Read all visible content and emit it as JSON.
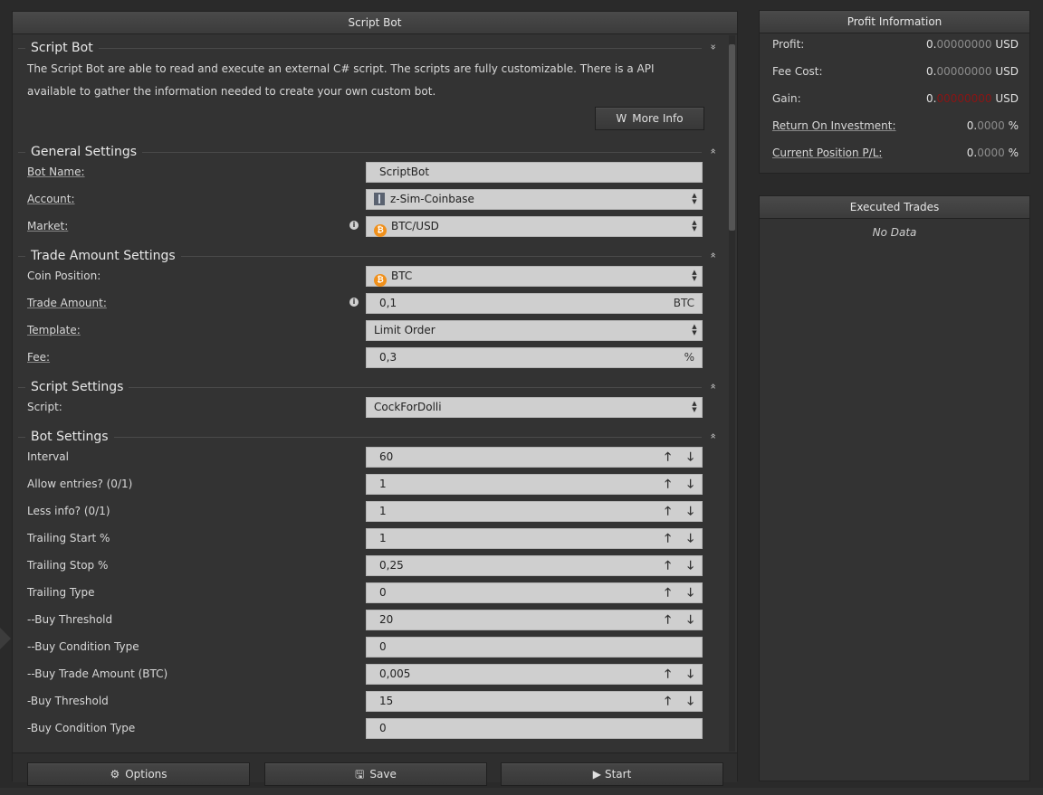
{
  "main": {
    "title": "Script Bot",
    "intro": {
      "title": "Script Bot",
      "toggle": "»",
      "description": "The Script Bot are able to read and execute an external C# script. The scripts are fully customizable. There is a API available to gather the information needed to create your own custom bot.",
      "more_info_label": "More Info",
      "more_info_icon": "W"
    },
    "general": {
      "title": "General Settings",
      "toggle": "«",
      "bot_name_label": "Bot Name:",
      "bot_name_value": "ScriptBot",
      "account_label": "Account:",
      "account_value": "z-Sim-Coinbase",
      "market_label": "Market:",
      "market_value": "BTC/USD"
    },
    "trade": {
      "title": "Trade Amount Settings",
      "toggle": "«",
      "coin_label": "Coin Position:",
      "coin_value": "BTC",
      "amount_label": "Trade Amount:",
      "amount_value": "0,1",
      "amount_suffix": "BTC",
      "template_label": "Template:",
      "template_value": "Limit Order",
      "fee_label": "Fee:",
      "fee_value": "0,3",
      "fee_suffix": "%"
    },
    "script": {
      "title": "Script Settings",
      "toggle": "«",
      "script_label": "Script:",
      "script_value": "CockForDolli"
    },
    "bot": {
      "title": "Bot Settings",
      "toggle": "«",
      "rows": [
        {
          "label": "Interval",
          "value": "60",
          "spin": true
        },
        {
          "label": "Allow entries? (0/1)",
          "value": "1",
          "spin": true
        },
        {
          "label": "Less info? (0/1)",
          "value": "1",
          "spin": true
        },
        {
          "label": "Trailing Start %",
          "value": "1",
          "spin": true
        },
        {
          "label": "Trailing Stop %",
          "value": "0,25",
          "spin": true
        },
        {
          "label": "Trailing Type",
          "value": "0",
          "spin": true
        },
        {
          "label": "--Buy Threshold",
          "value": "20",
          "spin": true
        },
        {
          "label": "--Buy Condition Type",
          "value": "0",
          "spin": false
        },
        {
          "label": "--Buy Trade Amount (BTC)",
          "value": "0,005",
          "spin": true
        },
        {
          "label": "-Buy Threshold",
          "value": "15",
          "spin": true
        },
        {
          "label": "-Buy Condition Type",
          "value": "0",
          "spin": false
        }
      ]
    },
    "buttons": {
      "options_label": "Options",
      "save_label": "Save",
      "start_label": "Start"
    }
  },
  "profit": {
    "title": "Profit Information",
    "profit_label": "Profit:",
    "profit_int": "0.",
    "profit_dec": "00000000",
    "profit_unit": "USD",
    "fee_label": "Fee Cost:",
    "fee_int": "0.",
    "fee_dec": "00000000",
    "fee_unit": "USD",
    "gain_label": "Gain:",
    "gain_int": "0.",
    "gain_dec": "00000000",
    "gain_unit": "USD",
    "roi_label": "Return On Investment:",
    "roi_int": "0.",
    "roi_dec": "0000",
    "roi_unit": "%",
    "pos_label": "Current Position P/L:",
    "pos_int": "0.",
    "pos_dec": "0000",
    "pos_unit": "%"
  },
  "trades": {
    "title": "Executed Trades",
    "empty": "No Data"
  },
  "colors": {
    "gain_negative": "#e01b1b",
    "coin_btc": "#f0901b"
  }
}
